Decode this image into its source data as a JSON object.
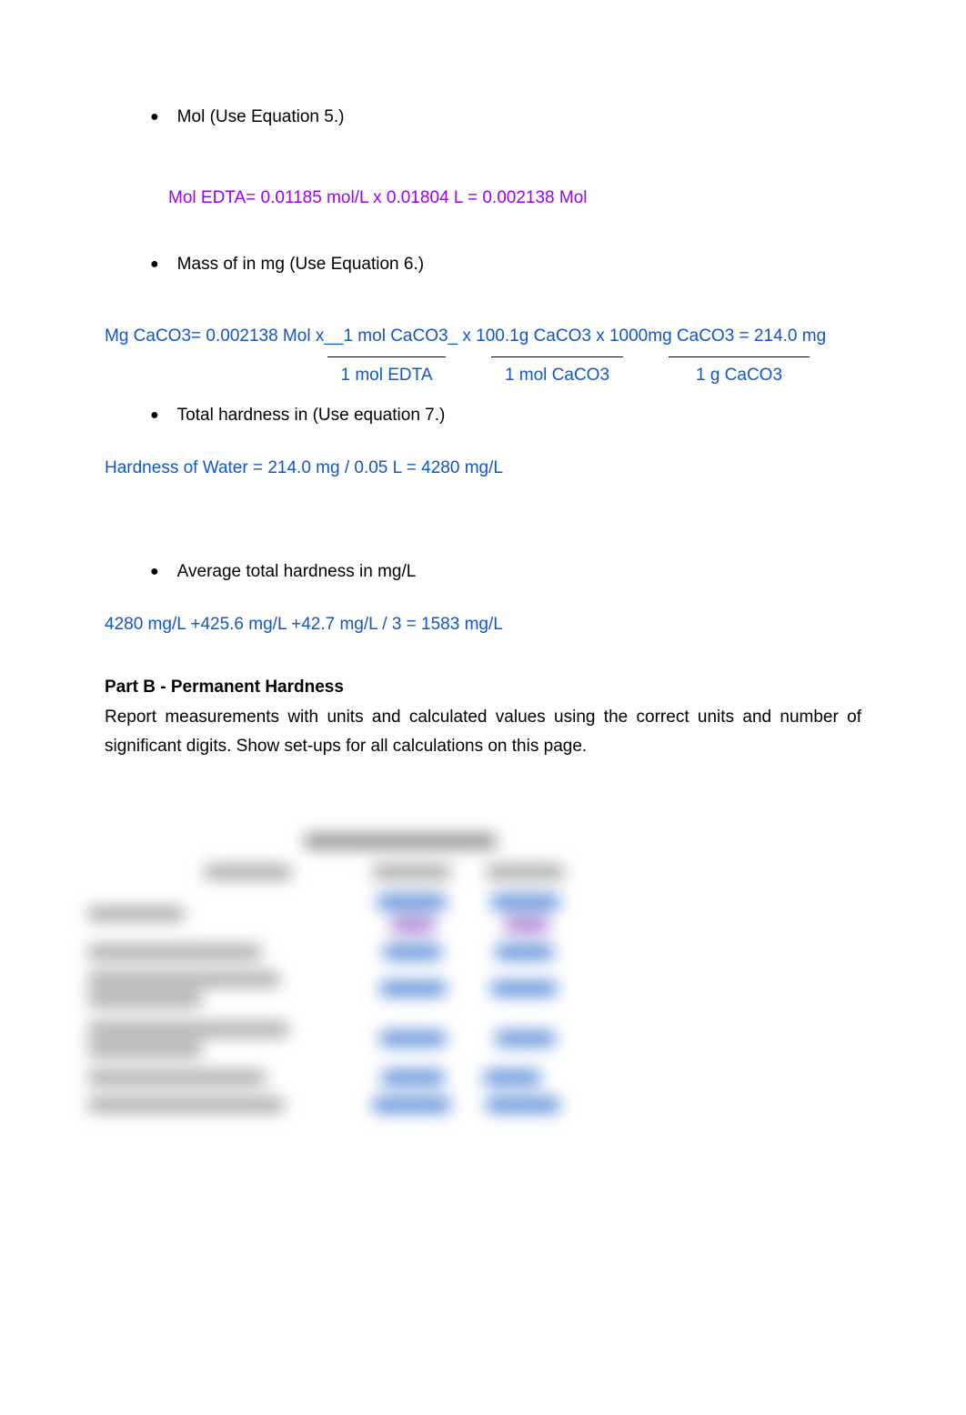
{
  "bullet1": {
    "text": "Mol  (Use Equation 5.)"
  },
  "calc1": "Mol EDTA= 0.01185 mol/L x 0.01804 L = 0.002138 Mol",
  "bullet2": {
    "text": "Mass of  in mg (Use Equation 6.)"
  },
  "calc2_line1": "Mg CaCO3= 0.002138 Mol x__1 mol CaCO3_ x  100.1g CaCO3 x  1000mg CaCO3   = 214.0 mg",
  "frac1_denom": "1 mol EDTA",
  "frac2_denom": "1 mol CaCO3",
  "frac3_denom": "1 g CaCO3",
  "bullet3": {
    "text": "Total hardness in (Use equation 7.)"
  },
  "calc3": "Hardness of Water = 214.0 mg / 0.05 L = 4280 mg/L",
  "bullet4": {
    "text": "Average total hardness in mg/L"
  },
  "calc4": "4280 mg/L +425.6 mg/L +42.7  mg/L  / 3 =  1583 mg/L",
  "partB_title": "Part B - Permanent Hardness",
  "partB_desc": "Report measurements with units and calculated values using the correct units and number of significant digits. Show set-ups for all calculations on this page."
}
